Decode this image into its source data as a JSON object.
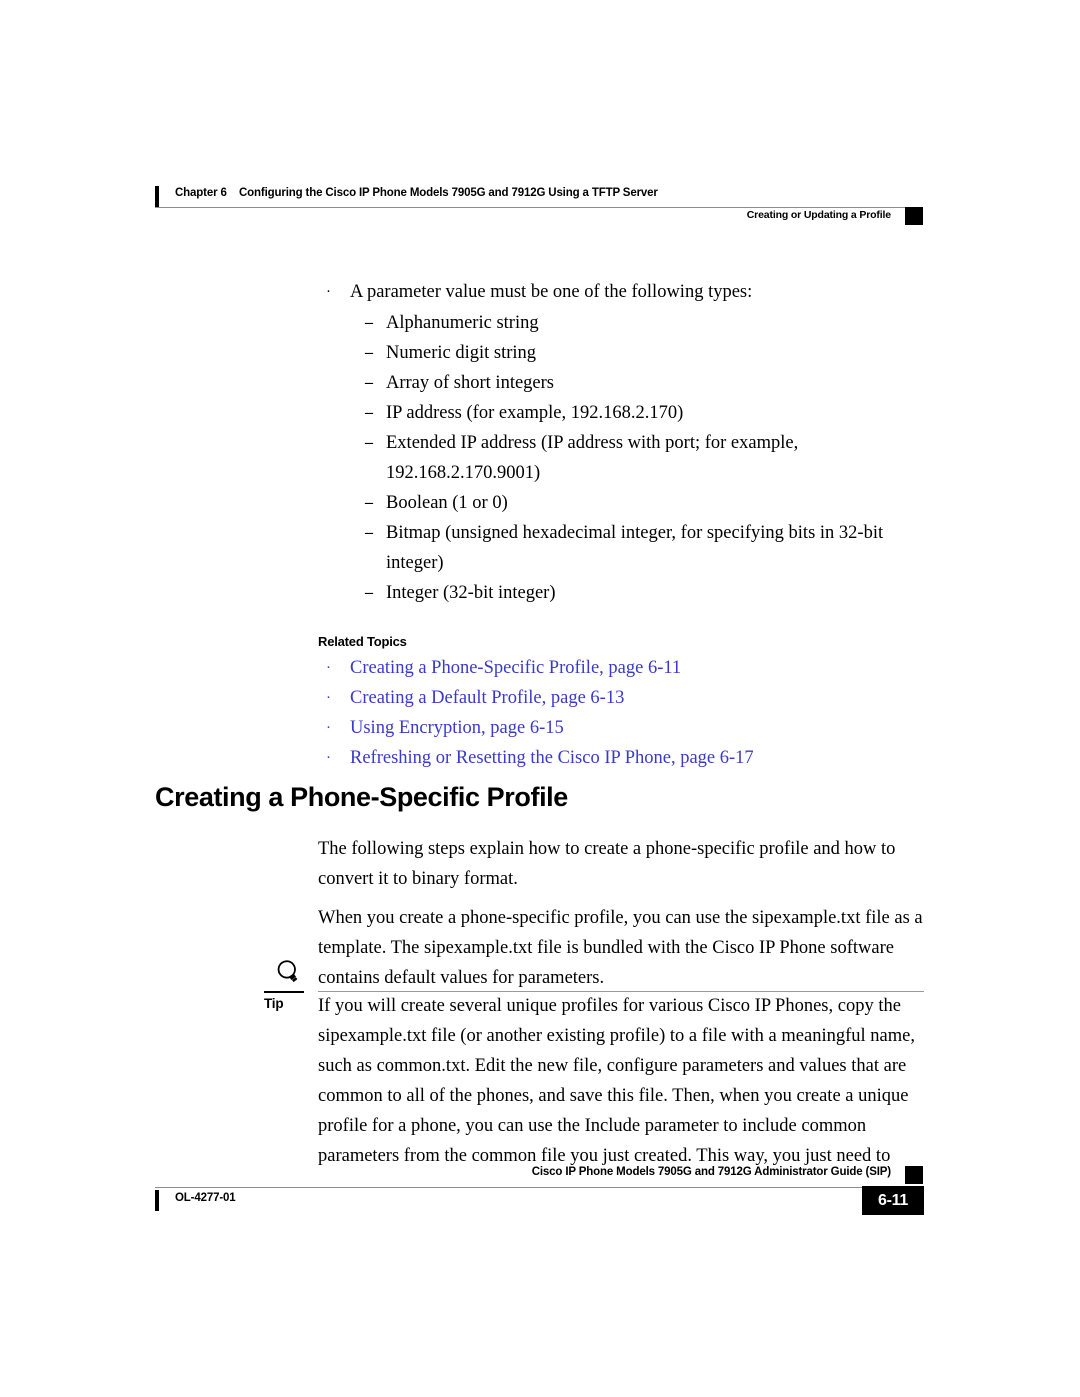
{
  "header": {
    "chapter_label": "Chapter 6",
    "chapter_title": "Configuring the Cisco IP Phone Models 7905G and 7912G Using a TFTP Server",
    "section_title": "Creating or Updating a Profile"
  },
  "content": {
    "intro_bullet": "A parameter value must be one of the following types:",
    "type_items": [
      {
        "text": "Alphanumeric string",
        "continuation": ""
      },
      {
        "text": "Numeric digit string",
        "continuation": ""
      },
      {
        "text": "Array of short integers",
        "continuation": ""
      },
      {
        "text": "IP address (for example, 192.168.2.170)",
        "continuation": ""
      },
      {
        "text": "Extended IP address (IP address with port; for example,",
        "continuation": "192.168.2.170.9001)"
      },
      {
        "text": "Boolean (1 or 0)",
        "continuation": ""
      },
      {
        "text": "Bitmap (unsigned hexadecimal integer, for specifying bits in 32-bit",
        "continuation": "integer)"
      },
      {
        "text": "Integer (32-bit integer)",
        "continuation": ""
      }
    ],
    "related_topics_heading": "Related Topics",
    "related_links": [
      "Creating a Phone-Specific Profile, page 6-11",
      "Creating a Default Profile, page 6-13",
      "Using Encryption, page 6-15",
      "Refreshing or Resetting the Cisco IP Phone, page 6-17"
    ],
    "link_color": "#3a3ac8",
    "bullet_marker": "·",
    "dash_marker": "–"
  },
  "section": {
    "heading": "Creating a Phone-Specific Profile",
    "paragraph_1": "The following steps explain how to create a phone-specific profile and how to convert it to binary format.",
    "paragraph_2": "When you create a phone-specific profile, you can use the sipexample.txt file as a template. The sipexample.txt file is bundled with the Cisco IP Phone software contains default values for parameters."
  },
  "tip": {
    "label": "Tip",
    "icon": "lightbulb-icon",
    "text": "If you will create several unique profiles for various Cisco IP Phones, copy the sipexample.txt file (or another existing profile) to a file with a meaningful name, such as common.txt. Edit the new file, configure parameters and values that are common to all of the phones, and save this file. Then, when you create a unique profile for a phone, you can use the Include parameter to include common parameters from the common file you just created. This way, you just need to"
  },
  "footer": {
    "guide_title": "Cisco IP Phone Models 7905G and 7912G Administrator Guide (SIP)",
    "doc_id": "OL-4277-01",
    "page_number": "6-11"
  }
}
